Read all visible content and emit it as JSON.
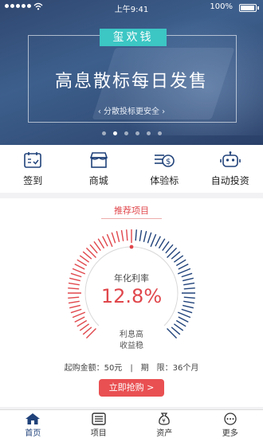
{
  "status_bar": {
    "time": "上午9:41",
    "battery": "100%"
  },
  "banner": {
    "brand": "玺欢钱",
    "headline": "高息散标每日发售",
    "subline": "分散投标更安全",
    "dot_count": 6,
    "active_dot": 1
  },
  "quick_nav": [
    {
      "label": "签到",
      "icon": "calendar-icon"
    },
    {
      "label": "商城",
      "icon": "shop-icon"
    },
    {
      "label": "体验标",
      "icon": "money-icon"
    },
    {
      "label": "自动投资",
      "icon": "robot-icon"
    }
  ],
  "product": {
    "section_title": "推荐项目",
    "rate_label": "年化利率",
    "rate": "12.8%",
    "rate_fraction": 0.5,
    "note_line1": "利息高",
    "note_line2": "收益稳",
    "min_amount": "起购金额：50元",
    "period": "期　限：36个月",
    "buy_button": "立即抢购 >"
  },
  "tabs": [
    {
      "label": "首页",
      "icon": "home-icon",
      "active": true
    },
    {
      "label": "项目",
      "icon": "list-icon",
      "active": false
    },
    {
      "label": "资产",
      "icon": "assets-icon",
      "active": false
    },
    {
      "label": "更多",
      "icon": "more-icon",
      "active": false
    }
  ],
  "colors": {
    "accent": "#e0474c",
    "navy": "#20427a",
    "teal": "#3cc6c4"
  }
}
